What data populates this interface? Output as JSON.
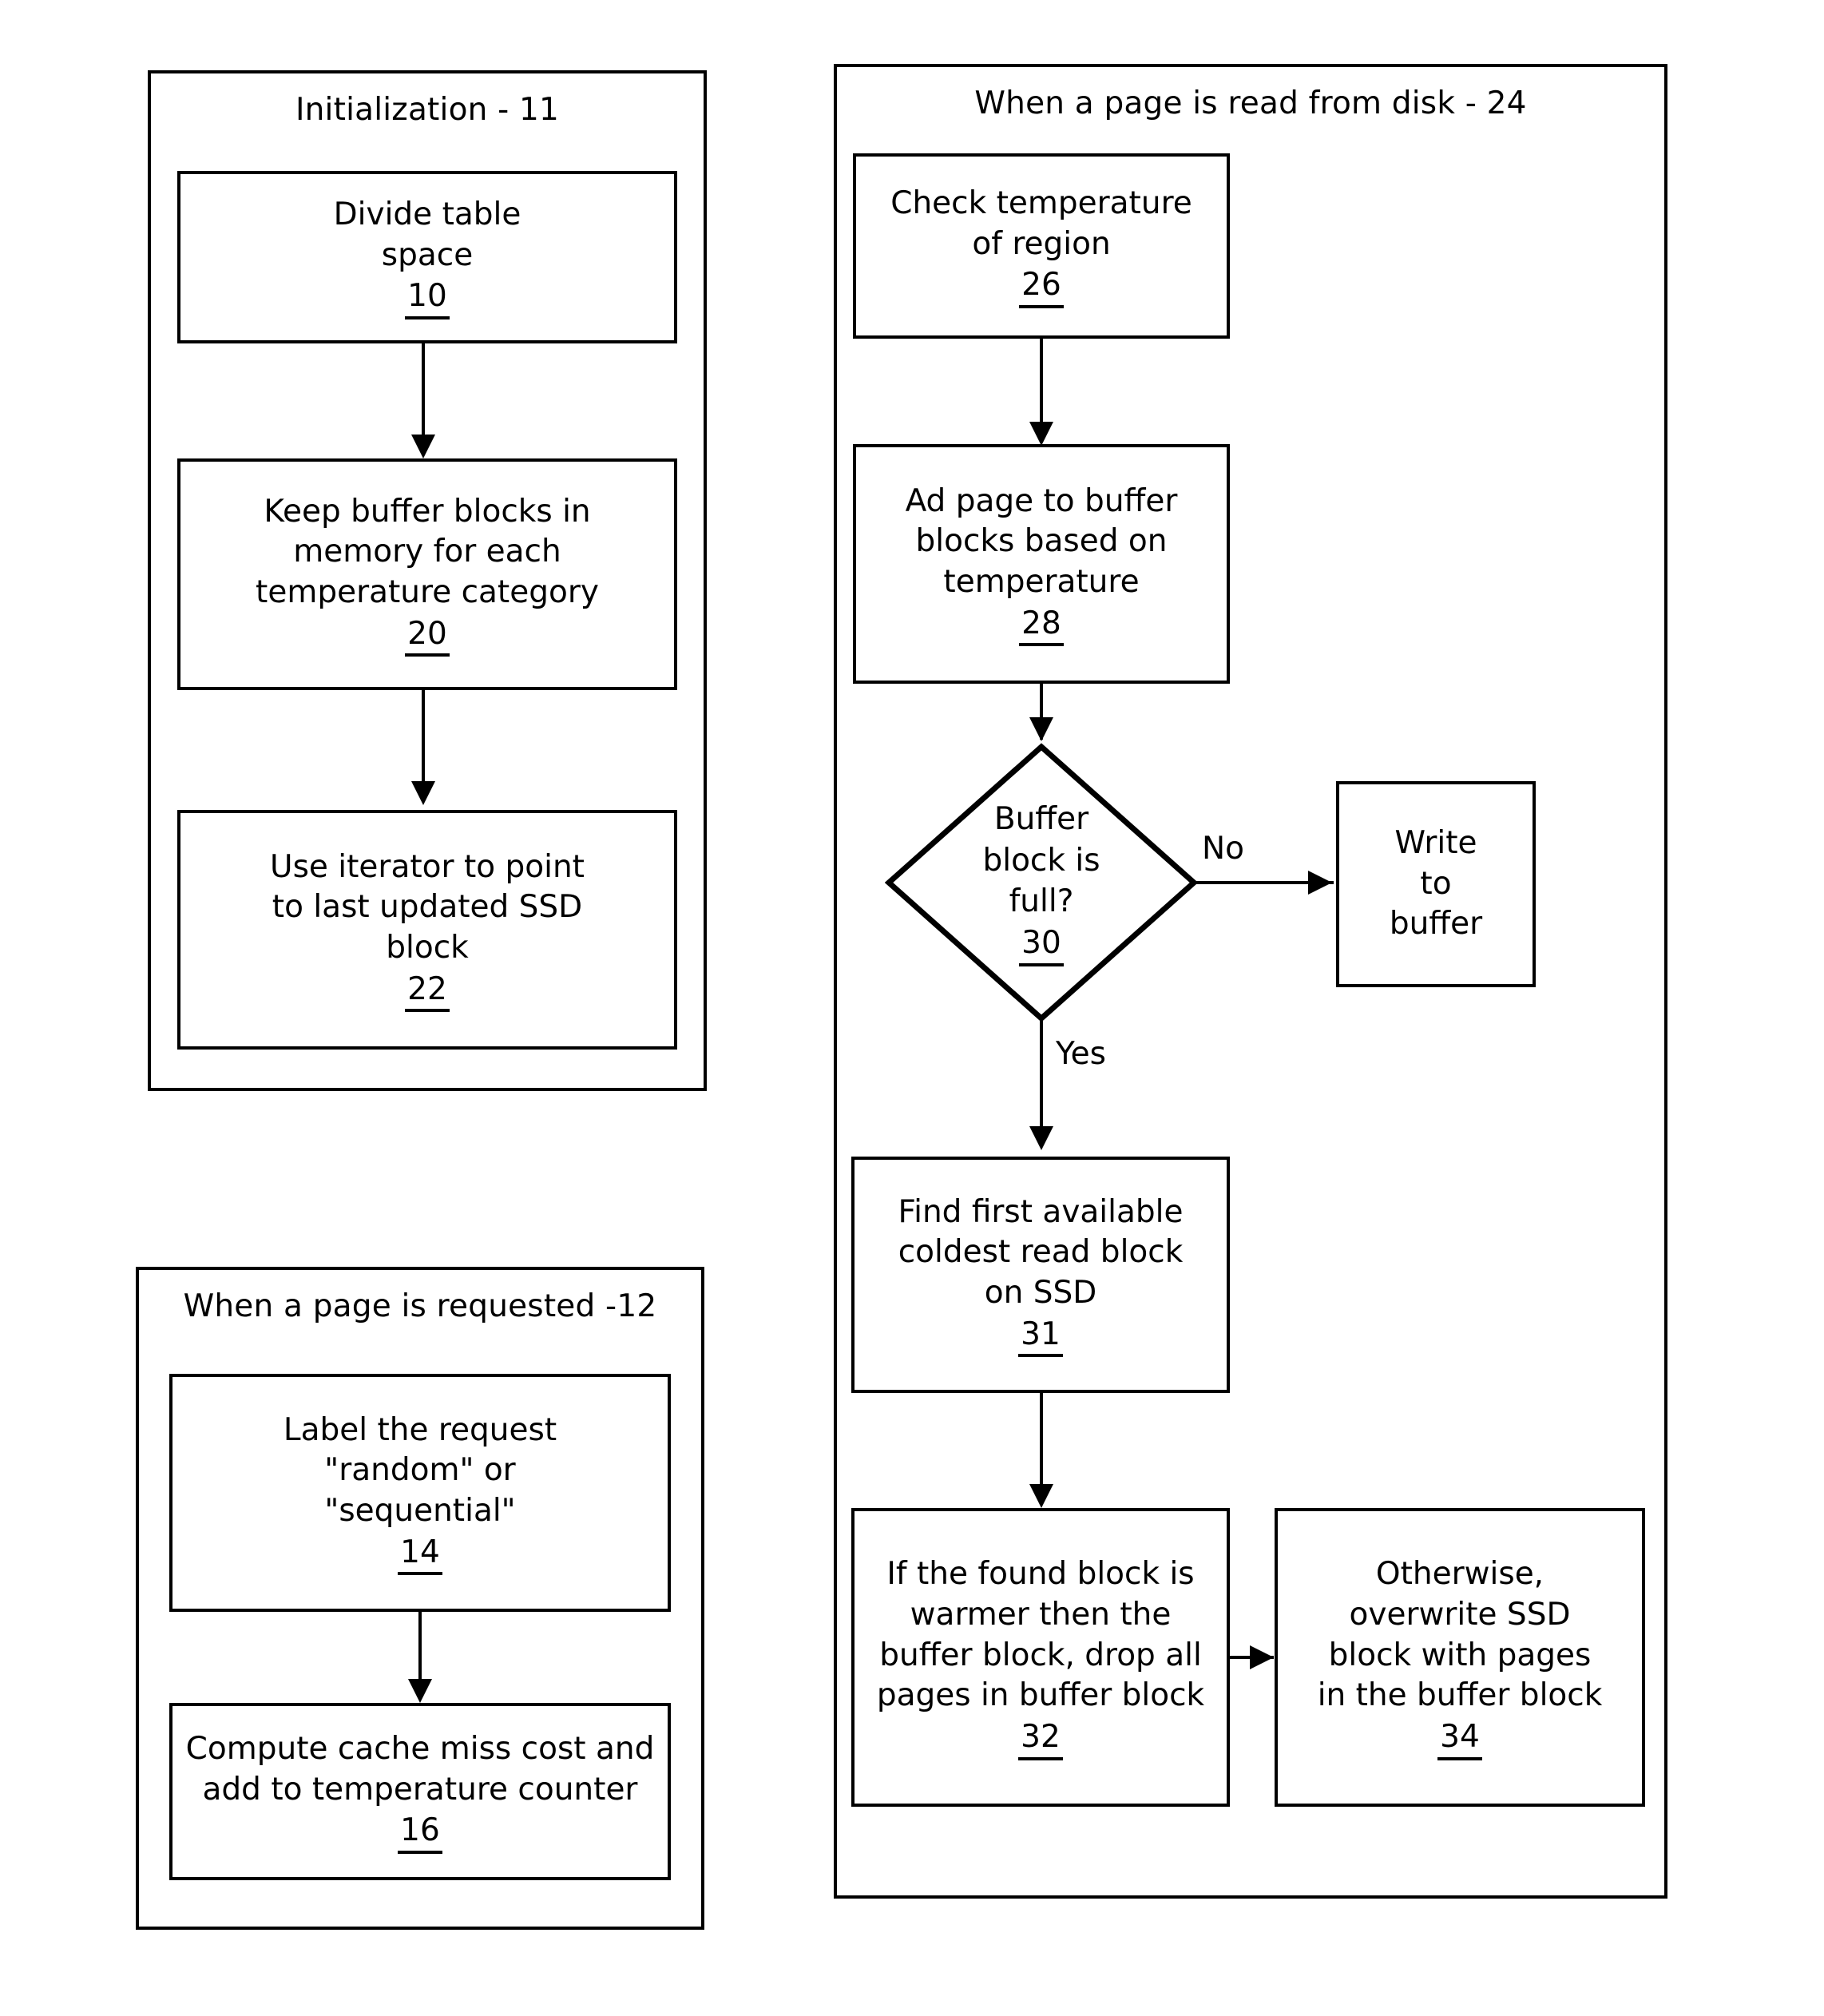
{
  "figure": {
    "type": "patent-flowchart",
    "background_color": "#ffffff",
    "line_color": "#000000"
  },
  "panels": {
    "initialization": {
      "title": "Initialization - 11",
      "steps": [
        {
          "lines": [
            "Divide table",
            "space"
          ],
          "ref": "10"
        },
        {
          "lines": [
            "Keep buffer blocks in",
            "memory for each",
            "temperature category"
          ],
          "ref": "20"
        },
        {
          "lines": [
            "Use iterator to point",
            "to last updated SSD",
            "block"
          ],
          "ref": "22"
        }
      ]
    },
    "page_requested": {
      "title": "When a page is requested -12",
      "steps": [
        {
          "lines": [
            "Label the request",
            "\"random\" or",
            "\"sequential\""
          ],
          "ref": "14"
        },
        {
          "lines": [
            "Compute cache miss cost and",
            "add to temperature counter"
          ],
          "ref": "16"
        }
      ]
    },
    "page_read_from_disk": {
      "title": "When a page is read from disk - 24",
      "steps": [
        {
          "lines": [
            "Check temperature",
            "of region"
          ],
          "ref": "26"
        },
        {
          "lines": [
            "Ad page to buffer",
            "blocks based on",
            "temperature"
          ],
          "ref": "28"
        }
      ],
      "decision": {
        "lines": [
          "Buffer",
          "block is",
          "full?"
        ],
        "ref": "30",
        "branch_no_label": "No",
        "branch_yes_label": "Yes"
      },
      "no_branch_step": {
        "lines": [
          "Write",
          "to",
          "buffer"
        ],
        "ref": ""
      },
      "after_yes_steps": [
        {
          "lines": [
            "Find first available",
            "coldest read block",
            "on SSD"
          ],
          "ref": "31"
        }
      ],
      "outcome_steps": [
        {
          "lines": [
            "If the found block is",
            "warmer then the",
            "buffer block, drop all",
            "pages in buffer block"
          ],
          "ref": "32"
        },
        {
          "lines": [
            "Otherwise,",
            "overwrite SSD",
            "block with pages",
            "in the buffer block"
          ],
          "ref": "34"
        }
      ]
    }
  }
}
